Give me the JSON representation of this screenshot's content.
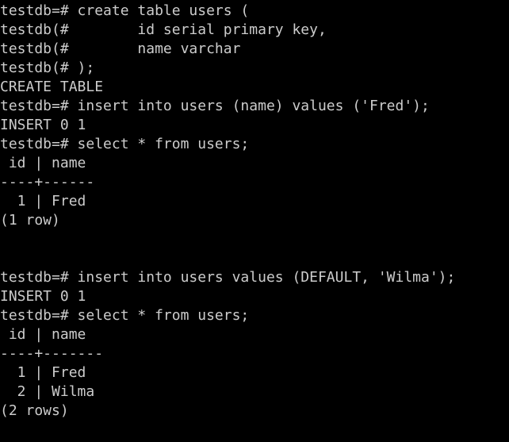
{
  "terminal": {
    "lines": [
      "testdb=# create table users (",
      "testdb(#        id serial primary key,",
      "testdb(#        name varchar",
      "testdb(# );",
      "CREATE TABLE",
      "testdb=# insert into users (name) values ('Fred');",
      "INSERT 0 1",
      "testdb=# select * from users;",
      " id | name",
      "----+------",
      "  1 | Fred",
      "(1 row)",
      "",
      "",
      "testdb=# insert into users values (DEFAULT, 'Wilma');",
      "INSERT 0 1",
      "testdb=# select * from users;",
      " id | name",
      "----+-------",
      "  1 | Fred",
      "  2 | Wilma",
      "(2 rows)"
    ],
    "colors": {
      "background": "#000000",
      "foreground": "#cccccc"
    }
  }
}
